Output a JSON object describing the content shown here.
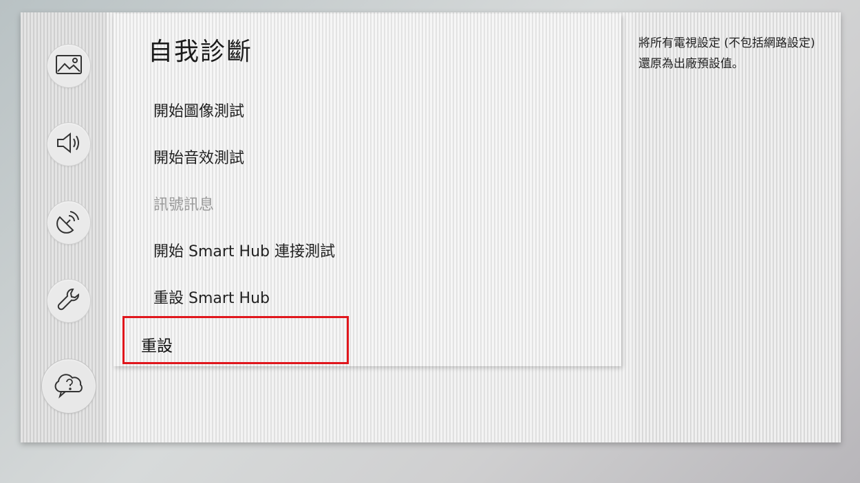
{
  "page": {
    "title": "自我診斷"
  },
  "sidebar": {
    "items": [
      {
        "name": "picture",
        "icon": "picture-icon"
      },
      {
        "name": "sound",
        "icon": "speaker-icon"
      },
      {
        "name": "broadcast",
        "icon": "satellite-dish-icon"
      },
      {
        "name": "general",
        "icon": "wrench-icon"
      },
      {
        "name": "support",
        "icon": "help-cloud-icon",
        "active": true
      }
    ]
  },
  "menu": {
    "items": [
      {
        "label": "開始圖像測試",
        "state": "normal"
      },
      {
        "label": "開始音效測試",
        "state": "normal"
      },
      {
        "label": "訊號訊息",
        "state": "disabled"
      },
      {
        "label": "開始 Smart Hub 連接測試",
        "state": "normal"
      },
      {
        "label": "重設 Smart Hub",
        "state": "normal"
      },
      {
        "label": "重設",
        "state": "selected"
      }
    ]
  },
  "description": {
    "text": "將所有電視設定 (不包括網路設定) 還原為出廠預設值。"
  },
  "colors": {
    "highlight": "#e0161c",
    "text": "#222222",
    "disabled_text": "#9a9a9a"
  }
}
